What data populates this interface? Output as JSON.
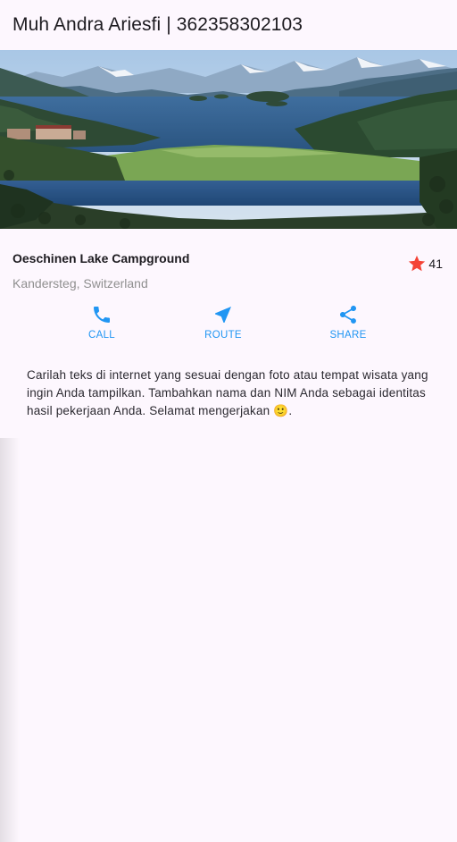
{
  "app_bar": {
    "title": "Muh Andra Ariesfi | 362358302103"
  },
  "title_section": {
    "name": "Oeschinen Lake Campground",
    "location": "Kandersteg, Switzerland",
    "rating_icon": "star-icon",
    "rating_count": "41"
  },
  "buttons": [
    {
      "icon": "phone-icon",
      "label": "CALL"
    },
    {
      "icon": "navigation-icon",
      "label": "ROUTE"
    },
    {
      "icon": "share-icon",
      "label": "SHARE"
    }
  ],
  "text_section": {
    "body": "Carilah teks di internet yang sesuai dengan foto atau tempat wisata yang ingin Anda tampilkan. Tambahkan nama dan NIM Anda sebagai identitas hasil pekerjaan Anda. Selamat mengerjakan 🙂."
  },
  "colors": {
    "accent": "#2196f3",
    "star": "#f44336",
    "background": "#fdf7fe"
  }
}
